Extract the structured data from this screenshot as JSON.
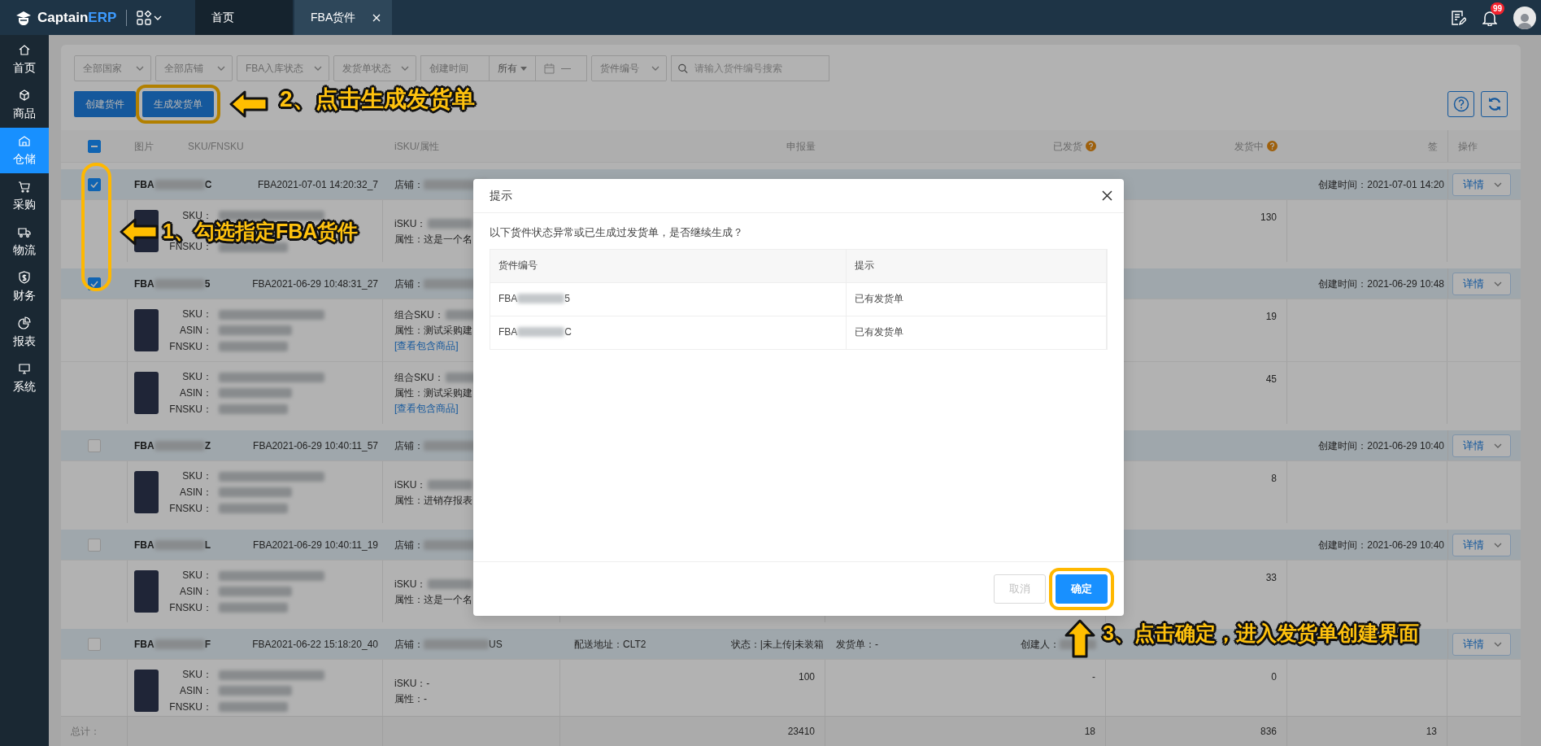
{
  "brand": {
    "text": "Captain",
    "accent": "ERP"
  },
  "tabs": [
    {
      "label": "首页",
      "selected": false,
      "closable": false
    },
    {
      "label": "FBA货件",
      "selected": true,
      "closable": true
    }
  ],
  "header": {
    "badge": "99"
  },
  "sidebar": {
    "items": [
      {
        "label": "首页",
        "selected": false
      },
      {
        "label": "商品",
        "selected": false
      },
      {
        "label": "仓储",
        "selected": true
      },
      {
        "label": "采购",
        "selected": false
      },
      {
        "label": "物流",
        "selected": false
      },
      {
        "label": "财务",
        "selected": false
      },
      {
        "label": "报表",
        "selected": false
      },
      {
        "label": "系统",
        "selected": false
      }
    ]
  },
  "filters": [
    {
      "kind": "select",
      "label": "全部国家"
    },
    {
      "kind": "select",
      "label": "全部店铺"
    },
    {
      "kind": "select",
      "label": "FBA入库状态"
    },
    {
      "kind": "select",
      "label": "发货单状态"
    },
    {
      "kind": "date",
      "label": "创建时间",
      "range": "所有",
      "separator": "—"
    },
    {
      "kind": "select",
      "label": "货件编号"
    },
    {
      "kind": "search",
      "placeholder": "请输入货件编号搜索"
    }
  ],
  "actions": [
    {
      "label": "创建货件",
      "highlighted": false
    },
    {
      "label": "生成发货单",
      "highlighted": true
    }
  ],
  "table": {
    "header_partial": true,
    "columns": [
      {
        "label": "图片",
        "help": false
      },
      {
        "label": "SKU/FNSKU",
        "help": false
      },
      {
        "label": "iSKU/属性",
        "help": false
      },
      {
        "label": "申报量",
        "help": false
      },
      {
        "label": "已发货",
        "help": true
      },
      {
        "label": "发货中",
        "help": true
      },
      {
        "label": "签",
        "help": false
      },
      {
        "label": "操作",
        "help": false
      }
    ]
  },
  "shipments": [
    {
      "checked": true,
      "id_start": "FBA",
      "id_end": "C",
      "name": "FBA2021-07-01 14:20:32_7",
      "store_label": "店铺：",
      "created": "创建时间：2021-07-01 14:20",
      "action": "详情",
      "items": [
        {
          "kind": "single",
          "sku_labels": [
            "SKU：",
            "FNSKU："
          ],
          "isku_label": "iSKU：",
          "attr": "属性：这是一个名",
          "shipping": "130"
        }
      ]
    },
    {
      "checked": true,
      "id_start": "FBA",
      "id_end": "5",
      "name": "FBA2021-06-29 10:48:31_27",
      "store_label": "店铺：",
      "created": "创建时间：2021-06-29 10:48",
      "action": "详情",
      "items": [
        {
          "kind": "combo",
          "sku_labels": [
            "SKU：",
            "ASIN：",
            "FNSKU："
          ],
          "isku_label": "组合SKU：",
          "attr": "属性：测试采购建",
          "link": "[查看包含商品]",
          "shipping": "19"
        },
        {
          "kind": "combo",
          "sku_labels": [
            "SKU：",
            "ASIN：",
            "FNSKU："
          ],
          "isku_label": "组合SKU：",
          "attr": "属性：测试采购建",
          "link": "[查看包含商品]",
          "shipping": "45"
        }
      ]
    },
    {
      "checked": false,
      "id_start": "FBA",
      "id_end": "Z",
      "name": "FBA2021-06-29 10:40:11_57",
      "store_label": "店铺：",
      "created": "创建时间：2021-06-29 10:40",
      "action": "详情",
      "items": [
        {
          "kind": "single",
          "sku_labels": [
            "SKU：",
            "ASIN：",
            "FNSKU："
          ],
          "isku_label": "iSKU：",
          "attr": "属性：进销存报表",
          "shipping": "8"
        }
      ]
    },
    {
      "checked": false,
      "id_start": "FBA",
      "id_end": "L",
      "name": "FBA2021-06-29 10:40:11_19",
      "store_label": "店铺：",
      "created": "创建时间：2021-06-29 10:40",
      "action": "详情",
      "items": [
        {
          "kind": "single",
          "sku_labels": [
            "SKU：",
            "ASIN：",
            "FNSKU："
          ],
          "isku_label": "iSKU：",
          "attr": "属性：这是一个名",
          "shipping": "33"
        }
      ]
    },
    {
      "checked": false,
      "id_start": "FBA",
      "id_end": "F",
      "name": "FBA2021-06-22 15:18:20_40",
      "store_label": "店铺：",
      "store_suffix": "US",
      "address": "配送地址：CLT2",
      "status": "状态：|未上传|未装箱",
      "invoice": "发货单：-",
      "creator": "创建人：",
      "action": "详情",
      "items": [
        {
          "kind": "plain",
          "sku_labels": [
            "SKU：",
            "ASIN：",
            "FNSKU："
          ],
          "isku_label": "iSKU：-",
          "attr": "属性：-",
          "declared": "100",
          "shipped": "-",
          "shipping": "0"
        }
      ]
    }
  ],
  "totals": {
    "label": "总计：",
    "values": [
      "23410",
      "18",
      "836",
      "13"
    ]
  },
  "modal": {
    "title": "提示",
    "message": "以下货件状态异常或已生成过发货单，是否继续生成？",
    "columns": [
      "货件编号",
      "提示"
    ],
    "rows": [
      {
        "id_start": "FBA",
        "id_end": "5",
        "note": "已有发货单"
      },
      {
        "id_start": "FBA",
        "id_end": "C",
        "note": "已有发货单"
      }
    ],
    "buttons": [
      {
        "label": "取消",
        "kind": "default",
        "disabled": true,
        "highlighted": false
      },
      {
        "label": "确定",
        "kind": "primary",
        "disabled": false,
        "highlighted": true
      }
    ]
  },
  "annotations": [
    {
      "text": "1、勾选指定FBA货件",
      "kind": "left"
    },
    {
      "text": "2、点击生成发货单",
      "kind": "left"
    },
    {
      "text": "3、点击确定，进入发货单创建界面",
      "kind": "up"
    }
  ]
}
